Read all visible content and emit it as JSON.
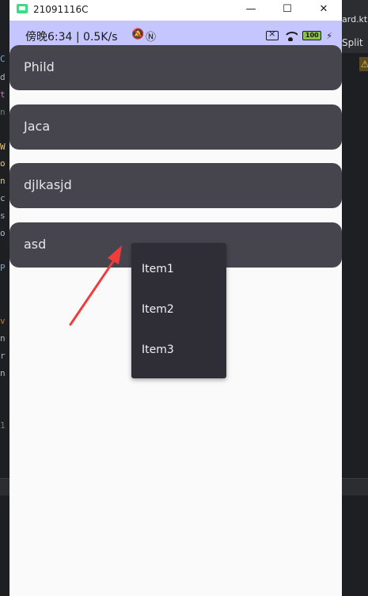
{
  "window": {
    "title": "21091116C",
    "minimize_symbol": "—",
    "maximize_symbol": "☐",
    "close_symbol": "✕"
  },
  "status_bar": {
    "left_text": "傍晚6:34 | 0.5K/s",
    "nfc_symbol": "Ⓝ",
    "battery_level": "100",
    "charging_symbol": "⚡",
    "icons": [
      "mute-notification-icon",
      "nfc-icon",
      "sim-off-icon",
      "wifi-icon",
      "battery-icon",
      "charging-icon"
    ]
  },
  "list": {
    "items": [
      {
        "label": "Phild"
      },
      {
        "label": "Jaca"
      },
      {
        "label": "djlkasjd"
      },
      {
        "label": "asd"
      }
    ]
  },
  "dropdown_menu": {
    "items": [
      {
        "label": "Item1"
      },
      {
        "label": "Item2"
      },
      {
        "label": "Item3"
      }
    ]
  },
  "ide_background": {
    "file_tab_fragment": "ard.kt",
    "split_label": "Split",
    "warning_symbol": "⚠"
  },
  "colors": {
    "row_background": "#46454e",
    "menu_background": "#2f2e36",
    "status_bar": "#c5c5ff",
    "content_background": "#fafafa",
    "annotation_arrow": "#f23c3c"
  }
}
